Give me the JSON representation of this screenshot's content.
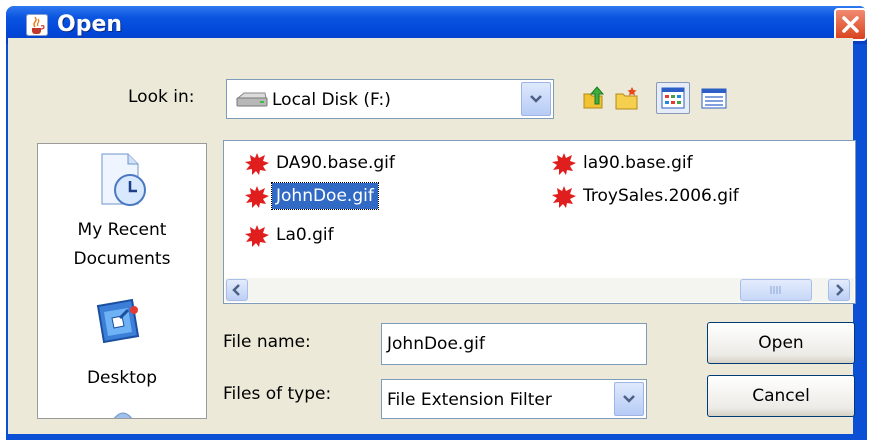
{
  "window": {
    "title": "Open",
    "title_icon": "java-cup-icon",
    "close_icon": "close-x-icon"
  },
  "look_in": {
    "label": "Look in:",
    "value": "Local Disk (F:)",
    "drive_icon": "hard-drive-icon"
  },
  "toolbar": {
    "icons": [
      "up-one-level-icon",
      "create-new-folder-icon",
      "list-view-icon",
      "details-view-icon"
    ],
    "active_view": "list-view-icon"
  },
  "places": [
    {
      "label_line1": "My Recent",
      "label_line2": "Documents",
      "icon": "recent-documents-icon"
    },
    {
      "label_line1": "Desktop",
      "label_line2": "",
      "icon": "desktop-icon"
    }
  ],
  "files": [
    {
      "name": "DA90.base.gif",
      "selected": false
    },
    {
      "name": "JohnDoe.gif",
      "selected": true
    },
    {
      "name": "La0.gif",
      "selected": false
    },
    {
      "name": "la90.base.gif",
      "selected": false
    },
    {
      "name": "TroySales.2006.gif",
      "selected": false
    }
  ],
  "file_name": {
    "label": "File name:",
    "value": "JohnDoe.gif"
  },
  "files_of_type": {
    "label": "Files of type:",
    "value": "File Extension Filter"
  },
  "buttons": {
    "open": "Open",
    "cancel": "Cancel"
  },
  "colors": {
    "titlebar": "#0b54e0",
    "selection": "#316ac5",
    "dialog_bg": "#ece9d8"
  }
}
